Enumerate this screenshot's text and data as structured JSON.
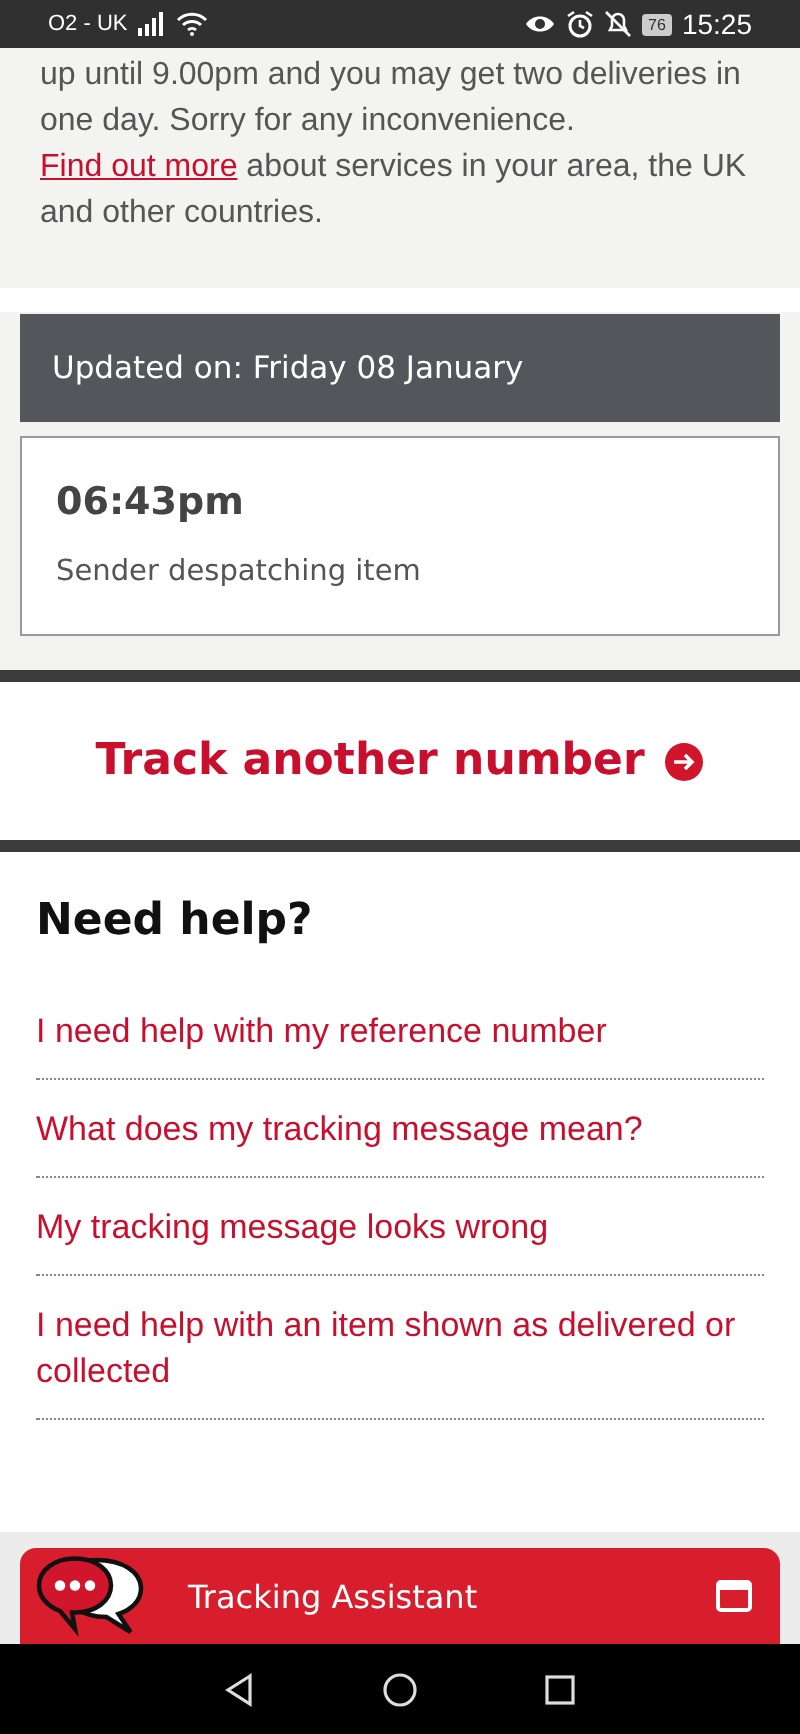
{
  "status_bar": {
    "carrier": "O2 - UK",
    "battery": "76",
    "time": "15:25"
  },
  "notice": {
    "lines_before_link": "up until 9.00pm and you may get two deliveries in one day. Sorry for any inconvenience.",
    "link": "Find out more",
    "after_link": "about services in your area, the UK and other countries."
  },
  "update": {
    "header": "Updated on: Friday 08 January",
    "time": "06:43pm",
    "message": "Sender despatching item"
  },
  "track_another": {
    "label": "Track another number"
  },
  "help": {
    "title": "Need help?",
    "links": [
      {
        "label": "I need help with my reference number"
      },
      {
        "label": "What does my tracking message mean?"
      },
      {
        "label": "My tracking message looks wrong"
      },
      {
        "label": "I need help with an item shown as delivered or collected"
      }
    ]
  },
  "assistant": {
    "label": "Tracking Assistant"
  }
}
